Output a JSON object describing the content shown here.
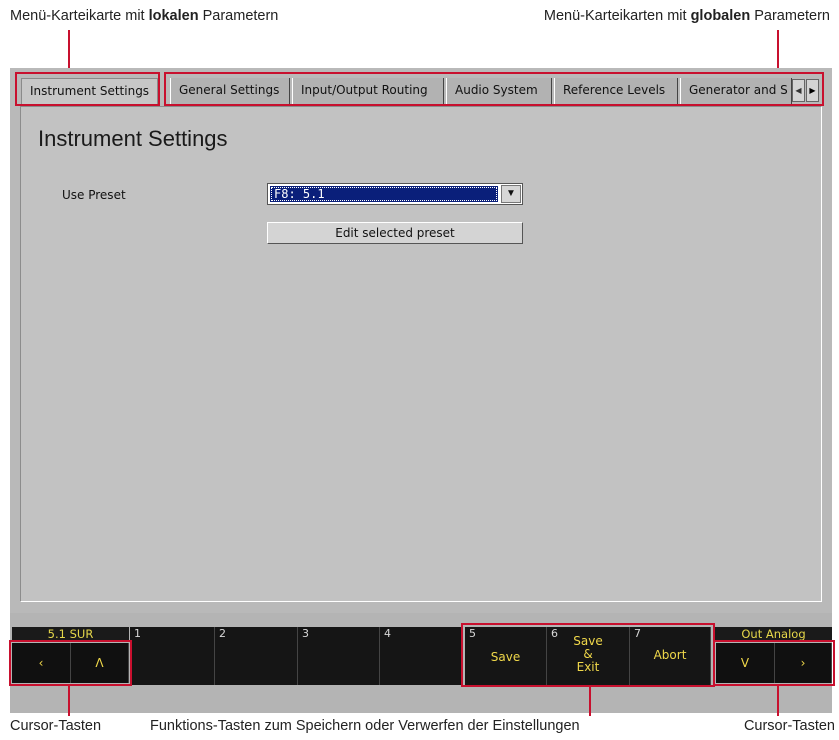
{
  "annotations": {
    "local_tab_pre": "Menü-Karteikarte mit ",
    "local_tab_bold": "lokalen",
    "local_tab_post": " Parametern",
    "global_tabs_pre": "Menü-Karteikarten mit ",
    "global_tabs_bold": "globalen",
    "global_tabs_post": " Parametern",
    "cursor_left": "Cursor-Tasten",
    "function_keys": "Funktions-Tasten zum Speichern oder Verwerfen der Einstellungen",
    "cursor_right": "Cursor-Tasten"
  },
  "tabs": {
    "local": "Instrument Settings",
    "global": [
      "General Settings",
      "Input/Output Routing",
      "Audio System",
      "Reference Levels",
      "Generator and S"
    ]
  },
  "panel": {
    "title": "Instrument Settings",
    "preset_label": "Use Preset",
    "preset_value": "F8: 5.1",
    "edit_button": "Edit selected preset"
  },
  "softkeys": {
    "left_label": "5.1 SUR",
    "right_label": "Out Analog",
    "cursor_left_1": "‹",
    "cursor_left_2": "Λ",
    "cursor_right_1": "V",
    "cursor_right_2": "›",
    "keys": [
      {
        "num": "1",
        "label": ""
      },
      {
        "num": "2",
        "label": ""
      },
      {
        "num": "3",
        "label": ""
      },
      {
        "num": "4",
        "label": ""
      },
      {
        "num": "5",
        "label": "Save"
      },
      {
        "num": "6",
        "label_line1": "Save",
        "label_line2": "&",
        "label_line3": "Exit"
      },
      {
        "num": "7",
        "label": "Abort"
      }
    ]
  },
  "colors": {
    "highlight": "#c8102e",
    "selection": "#0a1f7a",
    "softkey_text": "#f0d84a"
  }
}
